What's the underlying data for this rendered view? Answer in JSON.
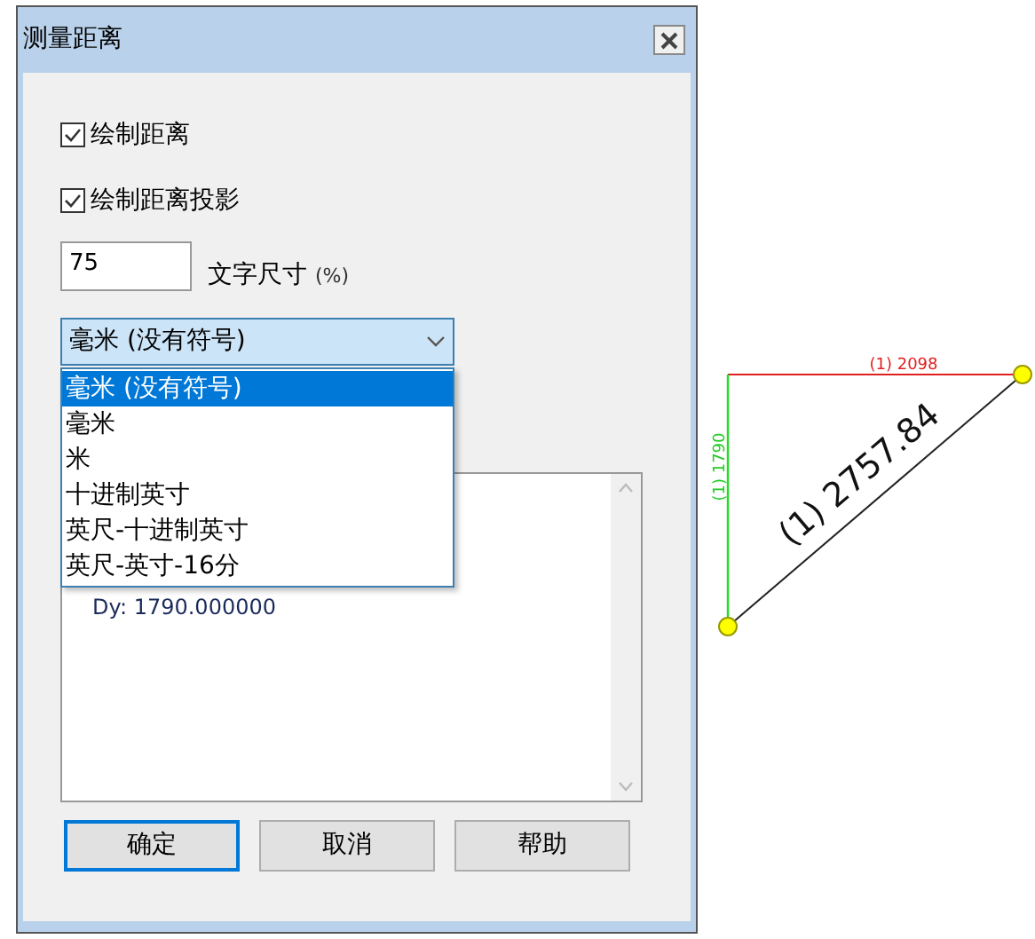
{
  "dialog": {
    "title": "测量距离",
    "checkboxes": [
      {
        "label": "绘制距离",
        "checked": true
      },
      {
        "label": "绘制距离投影",
        "checked": true
      }
    ],
    "text_size": {
      "value": "75",
      "label": "文字尺寸",
      "unit": "(%)"
    },
    "unit_dropdown": {
      "value": "毫米 (没有符号)",
      "expanded": true,
      "options": [
        {
          "label": "毫米 (没有符号)",
          "selected": true
        },
        {
          "label": "毫米",
          "selected": false
        },
        {
          "label": "米",
          "selected": false
        },
        {
          "label": "十进制英寸",
          "selected": false
        },
        {
          "label": "英尺-十进制英寸",
          "selected": false
        },
        {
          "label": "英尺-英寸-16分",
          "selected": false
        }
      ]
    },
    "results": {
      "lines": [
        "Dy: 1790.000000"
      ]
    },
    "buttons": [
      {
        "label": "确定",
        "default": true
      },
      {
        "label": "取消",
        "default": false
      },
      {
        "label": "帮助",
        "default": false
      }
    ]
  },
  "canvas": {
    "horizontal_label": "(1) 2098",
    "vertical_label": "(1) 1790",
    "distance_label": "(1) 2757.84"
  }
}
